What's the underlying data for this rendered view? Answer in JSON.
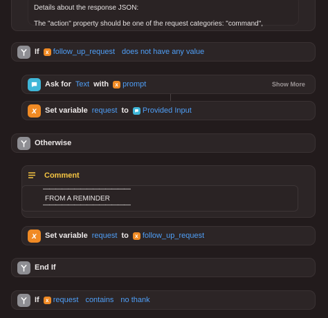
{
  "top_block": {
    "line1": "Details about the response JSON:",
    "line2": "The \"action\" property should be one of the request categories: \"command\","
  },
  "actions": {
    "if1": {
      "keyword": "If",
      "variable": "follow_up_request",
      "condition": "does not have any value"
    },
    "ask": {
      "keyword": "Ask for",
      "type": "Text",
      "with_label": "with",
      "variable": "prompt",
      "show_more": "Show More"
    },
    "setvar1": {
      "keyword": "Set variable",
      "name": "request",
      "to_label": "to",
      "value": "Provided Input"
    },
    "otherwise": {
      "keyword": "Otherwise"
    },
    "comment": {
      "title": "Comment",
      "line_top": "——————————————",
      "text": "FROM A REMINDER",
      "line_bottom": "——————————————"
    },
    "setvar2": {
      "keyword": "Set variable",
      "name": "request",
      "to_label": "to",
      "value": "follow_up_request"
    },
    "endif": {
      "keyword": "End If"
    },
    "if2": {
      "keyword": "If",
      "variable": "request",
      "condition": "contains",
      "value": "no thank"
    }
  },
  "icons": {
    "if": "branch-icon",
    "ask": "speech-bubble-icon",
    "setvar": "variable-x-icon",
    "comment": "comment-lines-icon"
  },
  "colors": {
    "background": "#221b1c",
    "block": "#2c2526",
    "token_blue": "#4f9ff7",
    "orange": "#f08a24",
    "gray": "#8e8e93",
    "cyan": "#3fb6d8",
    "comment_yellow": "#f5c542"
  }
}
